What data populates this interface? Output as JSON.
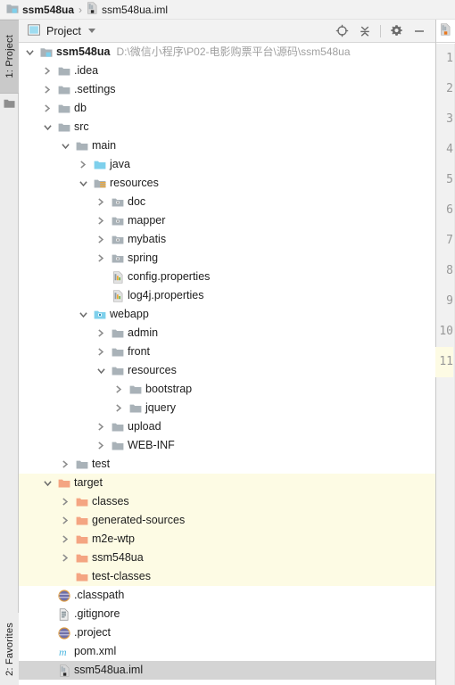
{
  "window": {
    "breadcrumb": [
      {
        "icon": "module-folder-icon",
        "label": "ssm548ua",
        "bold": true
      },
      {
        "icon": "iml-file-icon",
        "label": "ssm548ua.iml",
        "bold": false
      }
    ],
    "breadcrumb_separator": "›"
  },
  "left_strip": {
    "project_button": {
      "number": "1",
      "label": "1: Project",
      "icon": "project-folder-icon"
    },
    "favorites_button": {
      "number": "2",
      "label": "2: Favorites"
    }
  },
  "panel": {
    "title": "Project",
    "view_icon": "project-view-icon",
    "dropdown_icon": "chevron-down-icon",
    "actions": [
      {
        "name": "scroll-from-source-button",
        "icon": "crosshair-target-icon",
        "tooltip": "Select Opened File"
      },
      {
        "name": "collapse-all-button",
        "icon": "collapse-all-icon",
        "tooltip": "Collapse All"
      },
      {
        "name": "settings-button",
        "icon": "gear-icon",
        "tooltip": "Settings"
      },
      {
        "name": "hide-button",
        "icon": "minus-icon",
        "tooltip": "Hide"
      }
    ]
  },
  "colors": {
    "highlight_target": "#fdfbe4",
    "selection": "#d4d4d4",
    "folder_gray": "#a9b2b8",
    "folder_orange": "#f4a582",
    "source_blue": "#7ed0ec",
    "accent_orange": "#f0a732",
    "maven_blue": "#50b8e0"
  },
  "tree": [
    {
      "name": "ssm548ua",
      "depth": 0,
      "state": "expanded",
      "icon": "module-folder-icon",
      "bold": true,
      "note": "D:\\微信小程序\\P02-电影购票平台\\源码\\ssm548ua",
      "highlight": "none"
    },
    {
      "name": ".idea",
      "depth": 1,
      "state": "collapsed",
      "icon": "folder-icon",
      "bold": false,
      "note": "",
      "highlight": "none"
    },
    {
      "name": ".settings",
      "depth": 1,
      "state": "collapsed",
      "icon": "folder-icon",
      "bold": false,
      "note": "",
      "highlight": "none"
    },
    {
      "name": "db",
      "depth": 1,
      "state": "collapsed",
      "icon": "folder-icon",
      "bold": false,
      "note": "",
      "highlight": "none"
    },
    {
      "name": "src",
      "depth": 1,
      "state": "expanded",
      "icon": "folder-icon",
      "bold": false,
      "note": "",
      "highlight": "none"
    },
    {
      "name": "main",
      "depth": 2,
      "state": "expanded",
      "icon": "folder-icon",
      "bold": false,
      "note": "",
      "highlight": "none"
    },
    {
      "name": "java",
      "depth": 3,
      "state": "collapsed",
      "icon": "source-root-folder-icon",
      "bold": false,
      "note": "",
      "highlight": "none"
    },
    {
      "name": "resources",
      "depth": 3,
      "state": "expanded",
      "icon": "resource-root-folder-icon",
      "bold": false,
      "note": "",
      "highlight": "none"
    },
    {
      "name": "doc",
      "depth": 4,
      "state": "collapsed",
      "icon": "resource-folder-icon",
      "bold": false,
      "note": "",
      "highlight": "none"
    },
    {
      "name": "mapper",
      "depth": 4,
      "state": "collapsed",
      "icon": "resource-folder-icon",
      "bold": false,
      "note": "",
      "highlight": "none"
    },
    {
      "name": "mybatis",
      "depth": 4,
      "state": "collapsed",
      "icon": "resource-folder-icon",
      "bold": false,
      "note": "",
      "highlight": "none"
    },
    {
      "name": "spring",
      "depth": 4,
      "state": "collapsed",
      "icon": "resource-folder-icon",
      "bold": false,
      "note": "",
      "highlight": "none"
    },
    {
      "name": "config.properties",
      "depth": 4,
      "state": "leaf",
      "icon": "properties-file-icon",
      "bold": false,
      "note": "",
      "highlight": "none"
    },
    {
      "name": "log4j.properties",
      "depth": 4,
      "state": "leaf",
      "icon": "properties-file-icon",
      "bold": false,
      "note": "",
      "highlight": "none"
    },
    {
      "name": "webapp",
      "depth": 3,
      "state": "expanded",
      "icon": "webapp-root-folder-icon",
      "bold": false,
      "note": "",
      "highlight": "none"
    },
    {
      "name": "admin",
      "depth": 4,
      "state": "collapsed",
      "icon": "folder-icon",
      "bold": false,
      "note": "",
      "highlight": "none"
    },
    {
      "name": "front",
      "depth": 4,
      "state": "collapsed",
      "icon": "folder-icon",
      "bold": false,
      "note": "",
      "highlight": "none"
    },
    {
      "name": "resources",
      "depth": 4,
      "state": "expanded",
      "icon": "folder-icon",
      "bold": false,
      "note": "",
      "highlight": "none"
    },
    {
      "name": "bootstrap",
      "depth": 5,
      "state": "collapsed",
      "icon": "folder-icon",
      "bold": false,
      "note": "",
      "highlight": "none"
    },
    {
      "name": "jquery",
      "depth": 5,
      "state": "collapsed",
      "icon": "folder-icon",
      "bold": false,
      "note": "",
      "highlight": "none"
    },
    {
      "name": "upload",
      "depth": 4,
      "state": "collapsed",
      "icon": "folder-icon",
      "bold": false,
      "note": "",
      "highlight": "none"
    },
    {
      "name": "WEB-INF",
      "depth": 4,
      "state": "collapsed",
      "icon": "folder-icon",
      "bold": false,
      "note": "",
      "highlight": "none"
    },
    {
      "name": "test",
      "depth": 2,
      "state": "collapsed",
      "icon": "folder-icon",
      "bold": false,
      "note": "",
      "highlight": "none"
    },
    {
      "name": "target",
      "depth": 1,
      "state": "expanded",
      "icon": "excluded-folder-icon",
      "bold": false,
      "note": "",
      "highlight": "yellow"
    },
    {
      "name": "classes",
      "depth": 2,
      "state": "collapsed",
      "icon": "excluded-folder-icon",
      "bold": false,
      "note": "",
      "highlight": "yellow"
    },
    {
      "name": "generated-sources",
      "depth": 2,
      "state": "collapsed",
      "icon": "excluded-folder-icon",
      "bold": false,
      "note": "",
      "highlight": "yellow"
    },
    {
      "name": "m2e-wtp",
      "depth": 2,
      "state": "collapsed",
      "icon": "excluded-folder-icon",
      "bold": false,
      "note": "",
      "highlight": "yellow"
    },
    {
      "name": "ssm548ua",
      "depth": 2,
      "state": "collapsed",
      "icon": "excluded-folder-icon",
      "bold": false,
      "note": "",
      "highlight": "yellow"
    },
    {
      "name": "test-classes",
      "depth": 2,
      "state": "leaf",
      "icon": "excluded-folder-icon",
      "bold": false,
      "note": "",
      "highlight": "yellow"
    },
    {
      "name": ".classpath",
      "depth": 1,
      "state": "leaf",
      "icon": "xml-file-icon",
      "bold": false,
      "note": "",
      "highlight": "none"
    },
    {
      "name": ".gitignore",
      "depth": 1,
      "state": "leaf",
      "icon": "text-file-icon",
      "bold": false,
      "note": "",
      "highlight": "none"
    },
    {
      "name": ".project",
      "depth": 1,
      "state": "leaf",
      "icon": "xml-file-icon",
      "bold": false,
      "note": "",
      "highlight": "none"
    },
    {
      "name": "pom.xml",
      "depth": 1,
      "state": "leaf",
      "icon": "maven-file-icon",
      "bold": false,
      "note": "",
      "highlight": "none"
    },
    {
      "name": "ssm548ua.iml",
      "depth": 1,
      "state": "leaf",
      "icon": "iml-file-icon",
      "bold": false,
      "note": "",
      "highlight": "selected"
    }
  ],
  "editor": {
    "tab_icon": "iml-file-icon",
    "line_numbers": [
      "1",
      "2",
      "3",
      "4",
      "5",
      "6",
      "7",
      "8",
      "9",
      "10",
      "11"
    ],
    "highlighted_line": "11"
  }
}
